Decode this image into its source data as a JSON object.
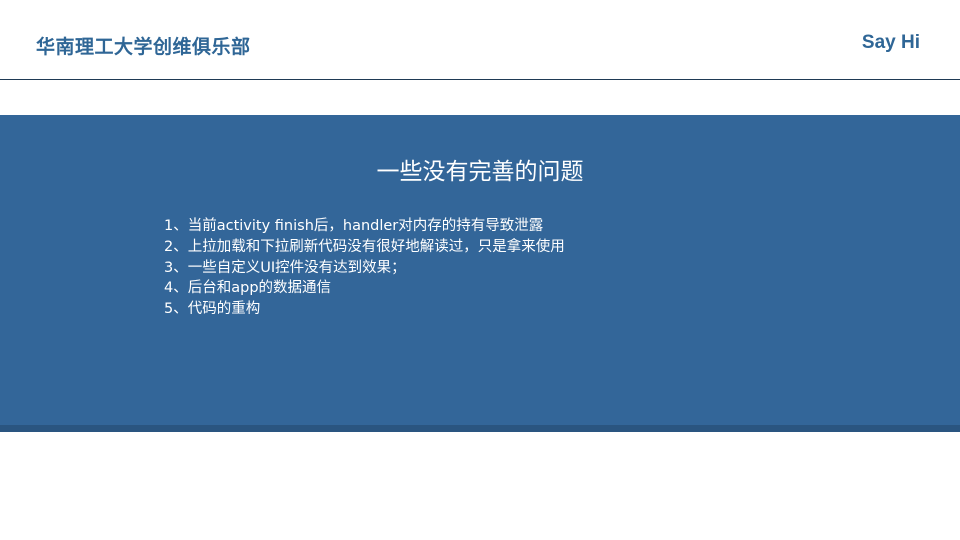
{
  "header": {
    "org_name": "华南理工大学创维俱乐部",
    "greeting": "Say Hi"
  },
  "slide": {
    "title": "一些没有完善的问题",
    "items": [
      "1、当前activity finish后，handler对内存的持有导致泄露",
      "2、上拉加载和下拉刷新代码没有很好地解读过，只是拿来使用",
      "3、一些自定义UI控件没有达到效果；",
      "4、后台和app的数据通信",
      "5、代码的重构"
    ]
  },
  "colors": {
    "brand": "#2f6696",
    "band": "#336699",
    "band_edge": "#2a5580"
  }
}
